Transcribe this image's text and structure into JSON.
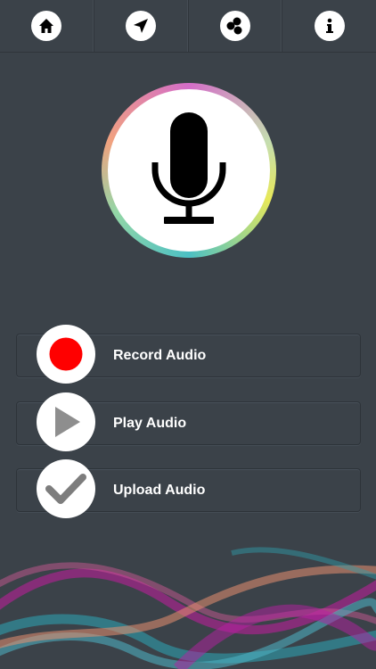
{
  "nav": {
    "items": [
      {
        "icon": "home-icon"
      },
      {
        "icon": "navigate-icon"
      },
      {
        "icon": "circles-icon"
      },
      {
        "icon": "info-icon"
      }
    ]
  },
  "hero": {
    "icon": "microphone-icon"
  },
  "actions": {
    "record": {
      "label": "Record Audio",
      "icon": "record-icon",
      "color": "#ff0000"
    },
    "play": {
      "label": "Play Audio",
      "icon": "play-icon",
      "color": "#8e8e8e"
    },
    "upload": {
      "label": "Upload Audio",
      "icon": "checkmark-icon",
      "color": "#7d7d7d"
    }
  },
  "colors": {
    "background": "#3b4249",
    "button_text": "#ffffff",
    "wave_colors": [
      "#c41e9e",
      "#2f9fae",
      "#e88f70",
      "#4fb7c7"
    ]
  }
}
